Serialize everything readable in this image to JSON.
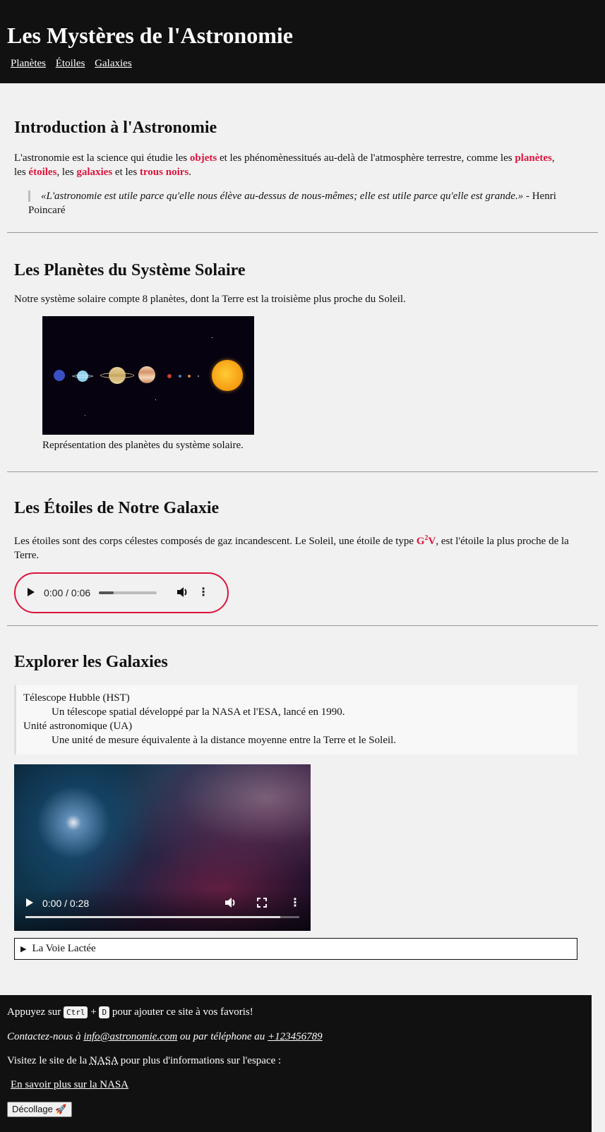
{
  "header": {
    "title": "Les Mystères de l'Astronomie",
    "nav": [
      "Planètes",
      "Étoiles",
      "Galaxies"
    ]
  },
  "intro": {
    "heading": "Introduction à l'Astronomie",
    "p_part1": "L'astronomie est la science qui étudie les ",
    "hl_objets": "objets",
    "p_part2": " et les phénomènessitués au-delà de l'atmosphère terrestre, comme les ",
    "hl_planetes": "planètes",
    "p_part3": ",",
    "p_part4": "les ",
    "hl_etoiles": "étoiles",
    "p_part5": ", les ",
    "hl_galaxies": "galaxies",
    "p_part6": " et les ",
    "hl_trous": "trous noirs",
    "p_part7": ".",
    "quote": "«L'astronomie est utile parce qu'elle nous élève au-dessus de nous-mêmes; elle est utile parce qu'elle est grande.»",
    "quote_author": " - Henri Poincaré"
  },
  "planets": {
    "heading": "Les Planètes du Système Solaire",
    "text": "Notre système solaire compte 8 planètes, dont la Terre est la troisième plus proche du Soleil.",
    "caption": "Représentation des planètes du système solaire."
  },
  "stars": {
    "heading": "Les Étoiles de Notre Galaxie",
    "p_part1": "Les étoiles sont des corps célestes composés de gaz incandescent. Le Soleil, une étoile de type ",
    "type_g": "G",
    "type_sup": "2",
    "type_v": "V",
    "p_part2": ", est l'étoile la plus proche de la Terre.",
    "audio": {
      "time": "0:00 / 0:06",
      "progress": 0.25
    }
  },
  "galaxies": {
    "heading": "Explorer les Galaxies",
    "dl": [
      {
        "term": "Télescope Hubble (HST)",
        "def": "Un télescope spatial développé par la NASA et l'ESA, lancé en 1990."
      },
      {
        "term": "Unité astronomique (UA)",
        "def": "Une unité de mesure équivalente à la distance moyenne entre la Terre et le Soleil."
      }
    ],
    "video": {
      "time": "0:00 / 0:28",
      "progress": 0.93
    },
    "details_summary": "La Voie Lactée"
  },
  "footer": {
    "fav_part1": "Appuyez sur ",
    "key1": "Ctrl",
    "plus": " + ",
    "key2": "D",
    "fav_part2": " pour ajouter ce site à vos favoris!",
    "contact_part1": "Contactez-nous à ",
    "email": "info@astronomie.com",
    "contact_part2": " ou par téléphone au ",
    "phone": "+123456789",
    "visit_part1": "Visitez le site de la ",
    "nasa_abbr": "NASA",
    "visit_part2": " pour plus d'informations sur l'espace :",
    "nasa_link": "En savoir plus sur la NASA",
    "button": "Décollage 🚀"
  },
  "colors": {
    "accent": "#dc143c",
    "header_bg": "#111111",
    "page_bg": "#f1f1f1"
  }
}
